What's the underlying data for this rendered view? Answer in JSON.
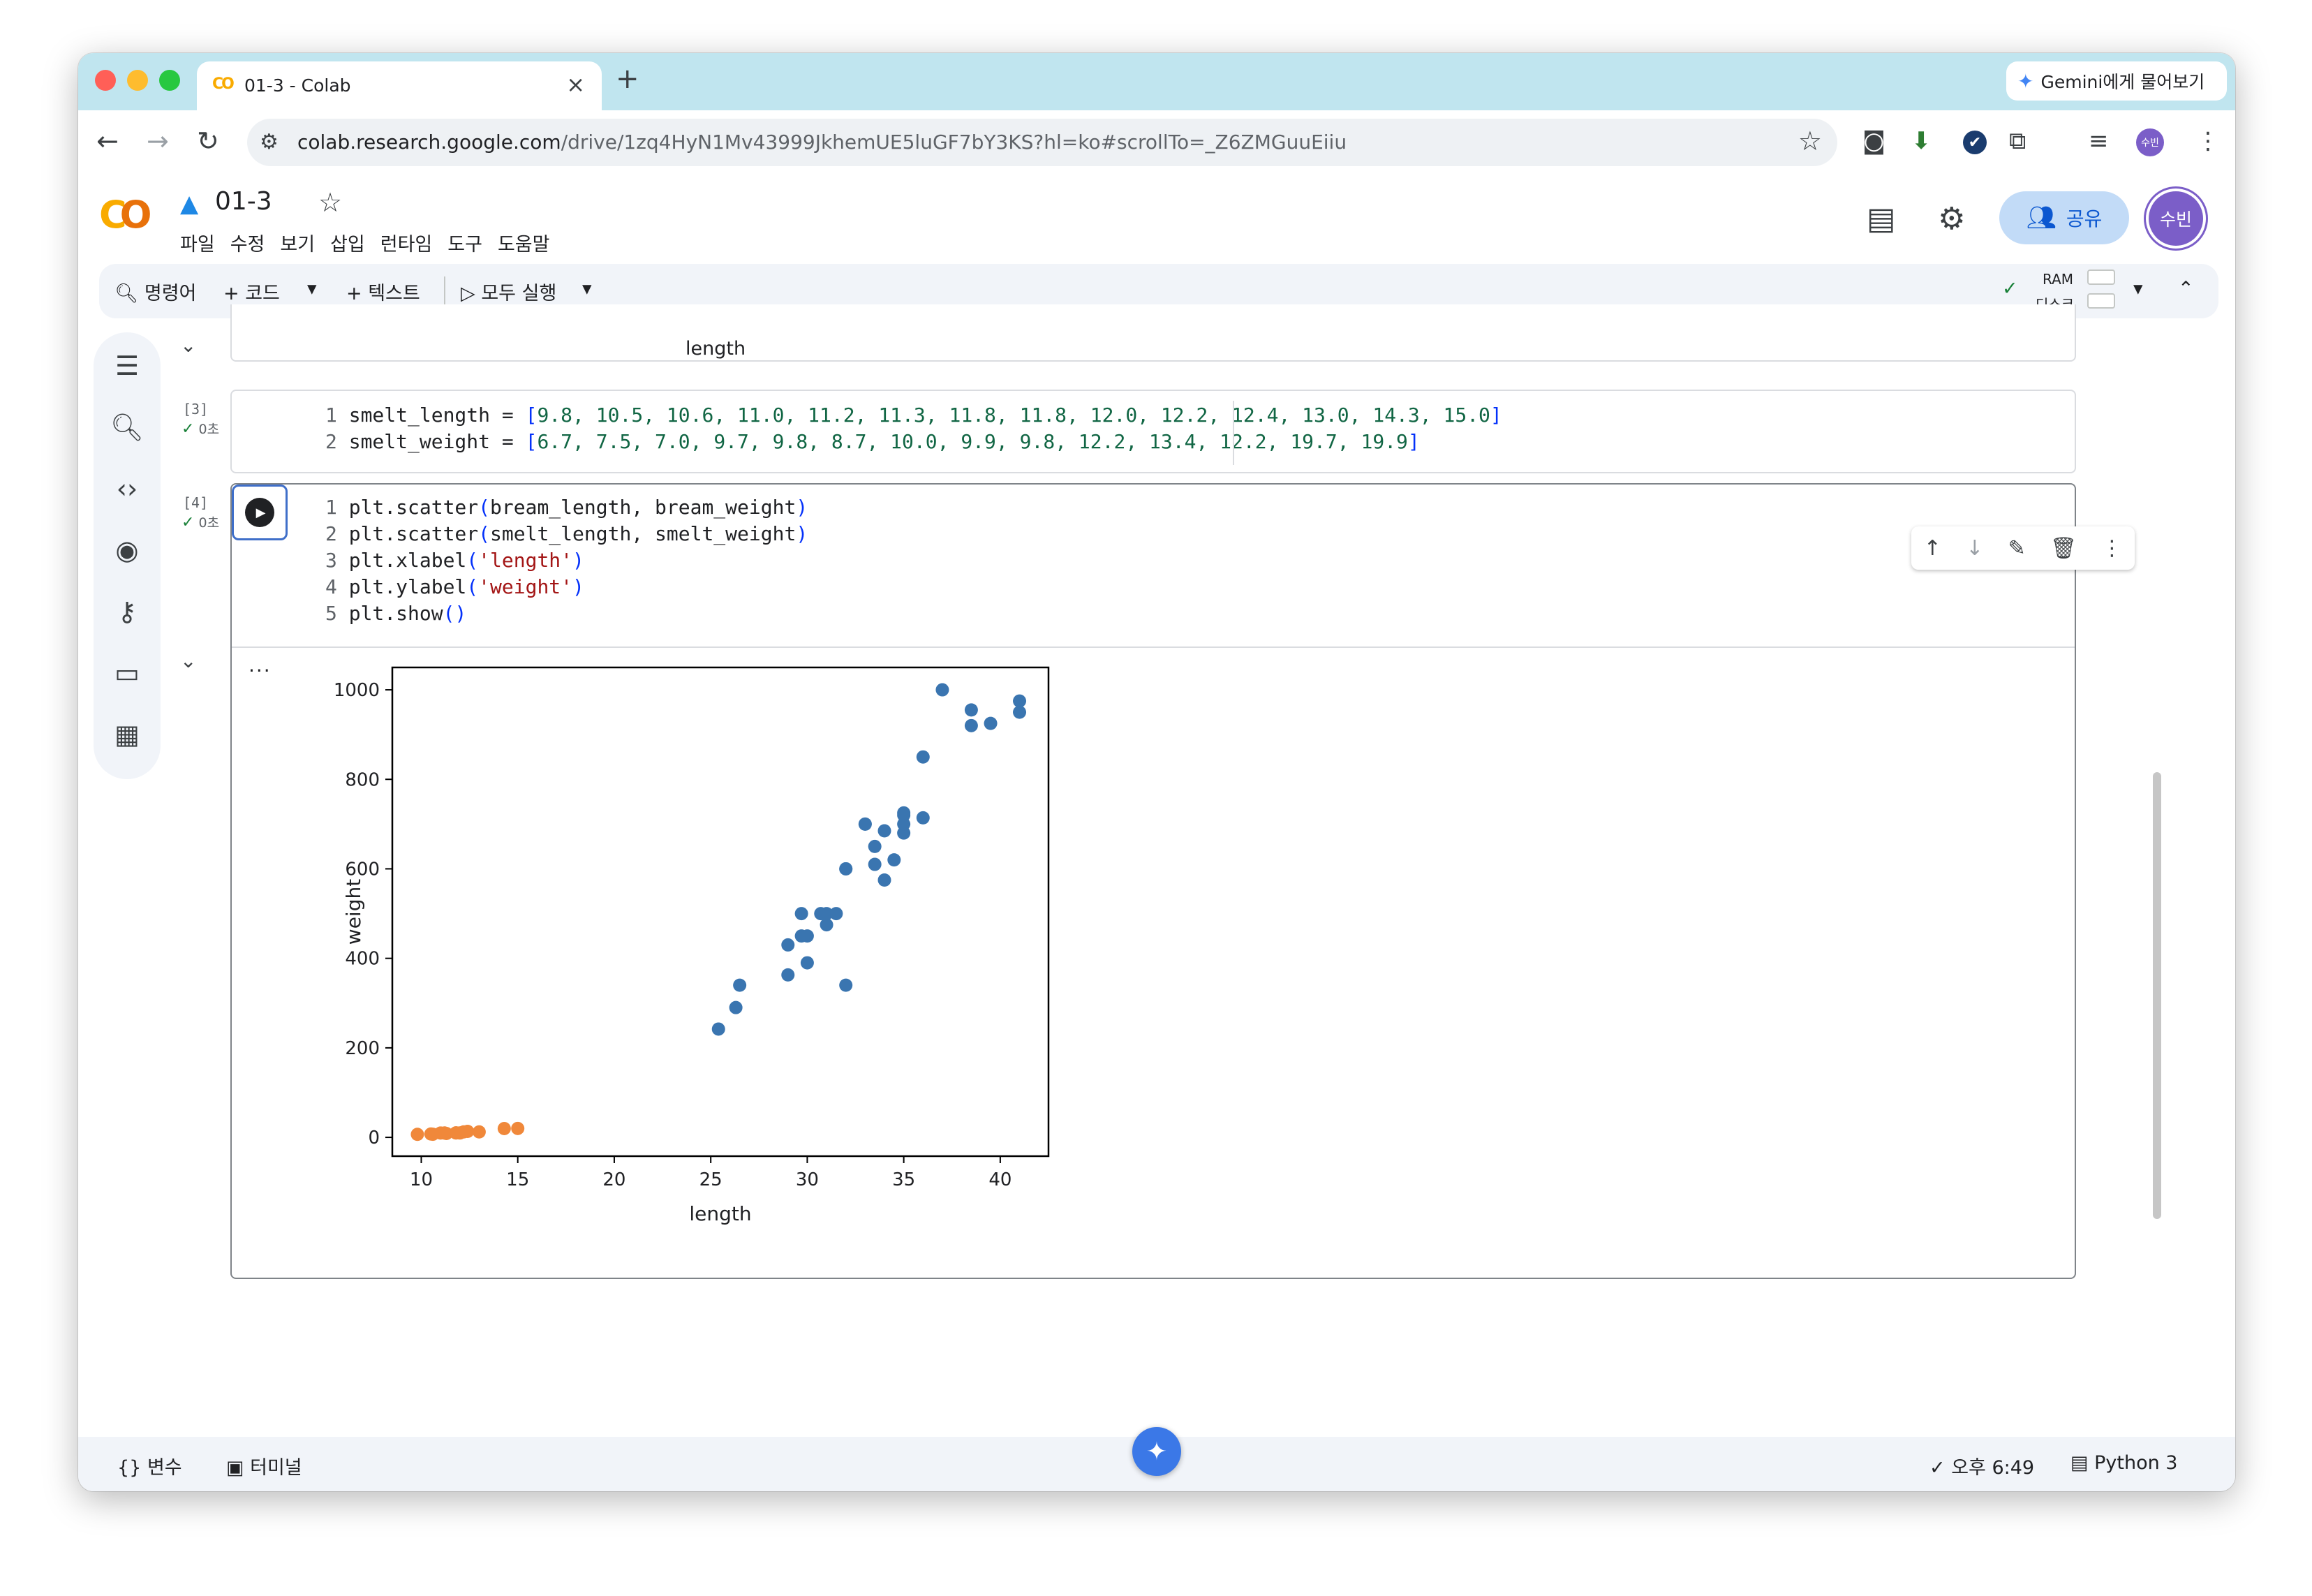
{
  "browser": {
    "tab_title": "01-3 - Colab",
    "tab_logo": "CO",
    "tab_close": "×",
    "new_tab": "+",
    "gemini_button": "Gemini에게 물어보기",
    "url_host": "colab.research.google.com",
    "url_path": "/drive/1zq4HyN1Mv43999JkhemUE5luGF7bY3KS?hl=ko#scrollTo=_Z6ZMGuuEiiu",
    "ext_avatar": "수빈"
  },
  "colab": {
    "logo": "CO",
    "title": "01-3",
    "menu": [
      "파일",
      "수정",
      "보기",
      "삽입",
      "런타임",
      "도구",
      "도움말"
    ],
    "share_label": "공유",
    "user_avatar": "수빈"
  },
  "toolbar": {
    "command": "명령어",
    "code": "+ 코드",
    "text": "+ 텍스트",
    "run_all": "▷ 모두 실행",
    "ram": "RAM",
    "disk": "디스크"
  },
  "cells": {
    "prev_output_label": "length",
    "cell3": {
      "count": "[3]",
      "time": "0초",
      "lines": [
        {
          "n": "1",
          "name": "smelt_length",
          "values": "9.8, 10.5, 10.6, 11.0, 11.2, 11.3, 11.8, 11.8, 12.0, 12.2, 12.4, 13.0, 14.3, 15.0"
        },
        {
          "n": "2",
          "name": "smelt_weight",
          "values": "6.7, 7.5, 7.0, 9.7, 9.8, 8.7, 10.0, 9.9, 9.8, 12.2, 13.4, 12.2, 19.7, 19.9"
        }
      ]
    },
    "cell4": {
      "count": "[4]",
      "time": "0초",
      "lines": [
        {
          "n": "1",
          "fn": "plt.scatter",
          "args": "bream_length, bream_weight"
        },
        {
          "n": "2",
          "fn": "plt.scatter",
          "args": "smelt_length, smelt_weight"
        },
        {
          "n": "3",
          "fn": "plt.xlabel",
          "str": "'length'"
        },
        {
          "n": "4",
          "fn": "plt.ylabel",
          "str": "'weight'"
        },
        {
          "n": "5",
          "fn": "plt.show",
          "args": ""
        }
      ],
      "output_dots": "..."
    }
  },
  "statusbar": {
    "variables": "변수",
    "terminal": "터미널",
    "time": "오후 6:49",
    "runtime": "Python 3"
  },
  "colors": {
    "bream": "#3a75b0",
    "smelt": "#f0883a",
    "accent": "#0b57d0"
  },
  "chart_data": {
    "type": "scatter",
    "xlabel": "length",
    "ylabel": "weight",
    "xlim": [
      8.5,
      42.5
    ],
    "ylim": [
      -42,
      1050
    ],
    "xticks": [
      10,
      15,
      20,
      25,
      30,
      35,
      40
    ],
    "yticks": [
      0,
      200,
      400,
      600,
      800,
      1000
    ],
    "grid": false,
    "series": [
      {
        "color": "#3a75b0",
        "x": [
          25.4,
          26.3,
          26.5,
          29.0,
          29.0,
          29.7,
          29.7,
          30.0,
          30.0,
          30.7,
          31.0,
          31.0,
          31.5,
          32.0,
          32.0,
          32.0,
          33.0,
          33.0,
          33.5,
          33.5,
          34.0,
          34.0,
          34.5,
          35.0,
          35.0,
          35.0,
          35.0,
          36.0,
          36.0,
          37.0,
          38.5,
          38.5,
          39.5,
          41.0,
          41.0
        ],
        "y": [
          242.0,
          290.0,
          340.0,
          363.0,
          430.0,
          450.0,
          500.0,
          390.0,
          450.0,
          500.0,
          475.0,
          500.0,
          500.0,
          340.0,
          600.0,
          600.0,
          700.0,
          700.0,
          610.0,
          650.0,
          575.0,
          685.0,
          620.0,
          680.0,
          700.0,
          725.0,
          720.0,
          714.0,
          850.0,
          1000.0,
          920.0,
          955.0,
          925.0,
          975.0,
          950.0
        ]
      },
      {
        "color": "#f0883a",
        "x": [
          9.8,
          10.5,
          10.6,
          11.0,
          11.2,
          11.3,
          11.8,
          11.8,
          12.0,
          12.2,
          12.4,
          13.0,
          14.3,
          15.0
        ],
        "y": [
          6.7,
          7.5,
          7.0,
          9.7,
          9.8,
          8.7,
          10.0,
          9.9,
          9.8,
          12.2,
          13.4,
          12.2,
          19.7,
          19.9
        ]
      }
    ]
  }
}
